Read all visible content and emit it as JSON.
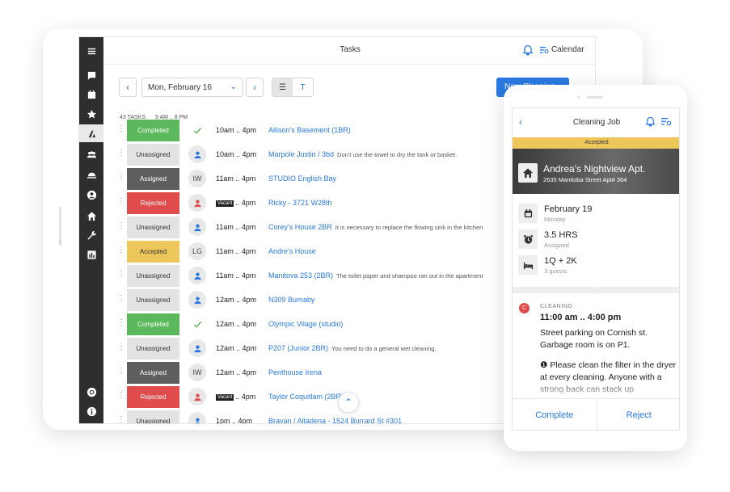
{
  "app": {
    "title": "Tasks",
    "calendar_label": "Calendar"
  },
  "toolbar": {
    "prev_label": "‹",
    "next_label": "›",
    "date_value": "Mon, February 16",
    "view_list_label": "☰",
    "view_text_label": "T",
    "new_button_label": "New Cleaning",
    "task_count": "43 TASKS",
    "time_range": "9 AM .. 8 PM"
  },
  "tasks": [
    {
      "status": "Completed",
      "assignee": "✓",
      "time": "10am .. 4pm",
      "vacant": "",
      "address": "Allison's Basement (1BR)",
      "note": ""
    },
    {
      "status": "Unassigned",
      "assignee": "",
      "time": "10am .. 4pm",
      "vacant": "",
      "address": "Marpole Justin / 3bd",
      "note": "Don't use the towel to dry the tank or basket."
    },
    {
      "status": "Assigned",
      "assignee": "IW",
      "time": "11am .. 4pm",
      "vacant": "",
      "address": "STUDIO English Bay",
      "note": ""
    },
    {
      "status": "Rejected",
      "assignee": "",
      "time": ".. 4pm",
      "vacant": "Vacant",
      "address": "Ricky - 3721 W28th",
      "note": ""
    },
    {
      "status": "Unassigned",
      "assignee": "",
      "time": "11am .. 4pm",
      "vacant": "",
      "address": "Corey's House 2BR",
      "note": "It is necessary to replace the flowing sink in the kitchen"
    },
    {
      "status": "Accepted",
      "assignee": "LG",
      "time": "11am .. 4pm",
      "vacant": "",
      "address": "Andre's House",
      "note": ""
    },
    {
      "status": "Unassigned",
      "assignee": "",
      "time": "11am .. 4pm",
      "vacant": "",
      "address": "Manitova 253 (2BR)",
      "note": "The toilet paper and shampoo ran out in the apartment"
    },
    {
      "status": "Unassigned",
      "assignee": "",
      "time": "12am .. 4pm",
      "vacant": "",
      "address": "N309 Burnaby",
      "note": ""
    },
    {
      "status": "Completed",
      "assignee": "✓",
      "time": "12am .. 4pm",
      "vacant": "",
      "address": "Olympic Vilage (studio)",
      "note": ""
    },
    {
      "status": "Unassigned",
      "assignee": "",
      "time": "12am .. 4pm",
      "vacant": "",
      "address": "P207 (Junior 2BR)",
      "note": "You need to do a general wet cleaning."
    },
    {
      "status": "Assigned",
      "assignee": "IW",
      "time": "12am .. 4pm",
      "vacant": "",
      "address": "Penthouse Irena",
      "note": ""
    },
    {
      "status": "Rejected",
      "assignee": "",
      "time": ".. 4pm",
      "vacant": "Vacant",
      "address": "Taylor Coquitlam (2BR)",
      "note": ""
    },
    {
      "status": "Unassigned",
      "assignee": "",
      "time": "1pm .. 4pm",
      "vacant": "",
      "address": "Brayan / Altadena - 1524 Burrard St #301",
      "note": ""
    }
  ],
  "phone": {
    "title": "Cleaning Job",
    "back_label": "‹",
    "status_badge": "Accepted",
    "property_name": "Andrea's Nightview Apt.",
    "property_address": "2635 Manitoba Street Apt# 364",
    "date_main": "February 19",
    "date_sub": "Monday",
    "duration_main": "3.5 HRS",
    "duration_sub": "Assigned",
    "beds_main": "1Q + 2K",
    "beds_sub": "3 guests",
    "task_letter": "C",
    "task_kind": "CLEANING",
    "task_time": "11:00 am .. 4:00 pm",
    "task_desc": "Street parking on Cornish st. Garbage room is on P1.",
    "task_note": "❶ Please clean the filter in the dryer at every cleaning. Anyone with a strong back can stack up",
    "complete_label": "Complete",
    "reject_label": "Reject"
  },
  "colors": {
    "accent": "#2a7ae2",
    "sidebar": "#2e2e2e",
    "unassigned": "#e3e3e3",
    "assigned": "#5e5e5e",
    "rejected": "#e04b4b",
    "accepted": "#eec75c",
    "completed": "#5cb85c"
  }
}
